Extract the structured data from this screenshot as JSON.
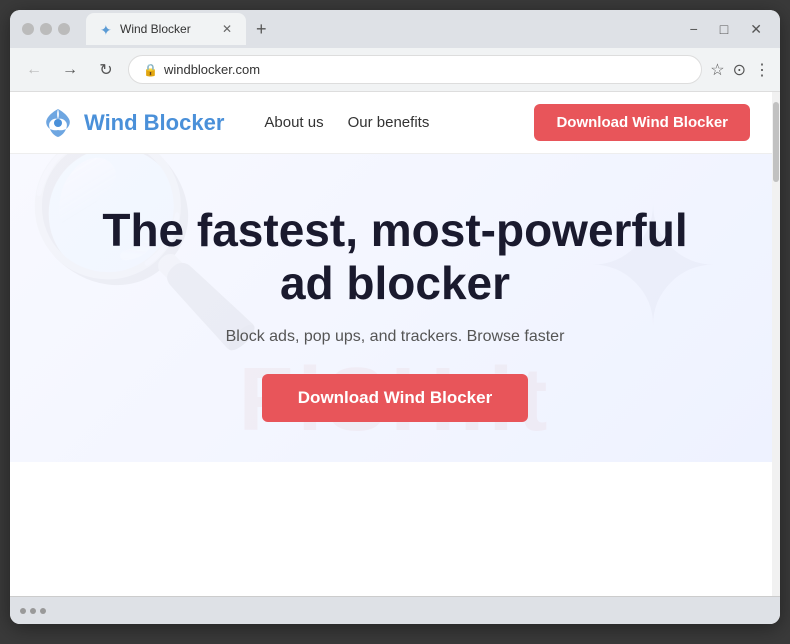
{
  "browser": {
    "tab_title": "Wind Blocker",
    "new_tab_icon": "+",
    "minimize_icon": "−",
    "maximize_icon": "□",
    "close_icon": "✕",
    "close_tab_icon": "✕",
    "back_icon": "←",
    "forward_icon": "→",
    "refresh_icon": "↻",
    "address": "windblocker.com",
    "lock_icon": "🔒",
    "star_icon": "☆",
    "profile_icon": "⊙",
    "menu_icon": "⋮",
    "bottom_dots": [
      "dot1",
      "dot2",
      "dot3"
    ]
  },
  "site": {
    "logo_icon": "✦",
    "logo_text": "Wind Blocker",
    "nav": {
      "about_label": "About us",
      "benefits_label": "Our benefits",
      "cta_label": "Download Wind Blocker"
    },
    "hero": {
      "heading_line1": "The fastest, most-powerful",
      "heading_line2": "ad blocker",
      "subtext": "Block ads, pop ups, and trackers. Browse faster",
      "cta_label": "Download Wind Blocker",
      "bg_text": "FiSH.it"
    }
  }
}
